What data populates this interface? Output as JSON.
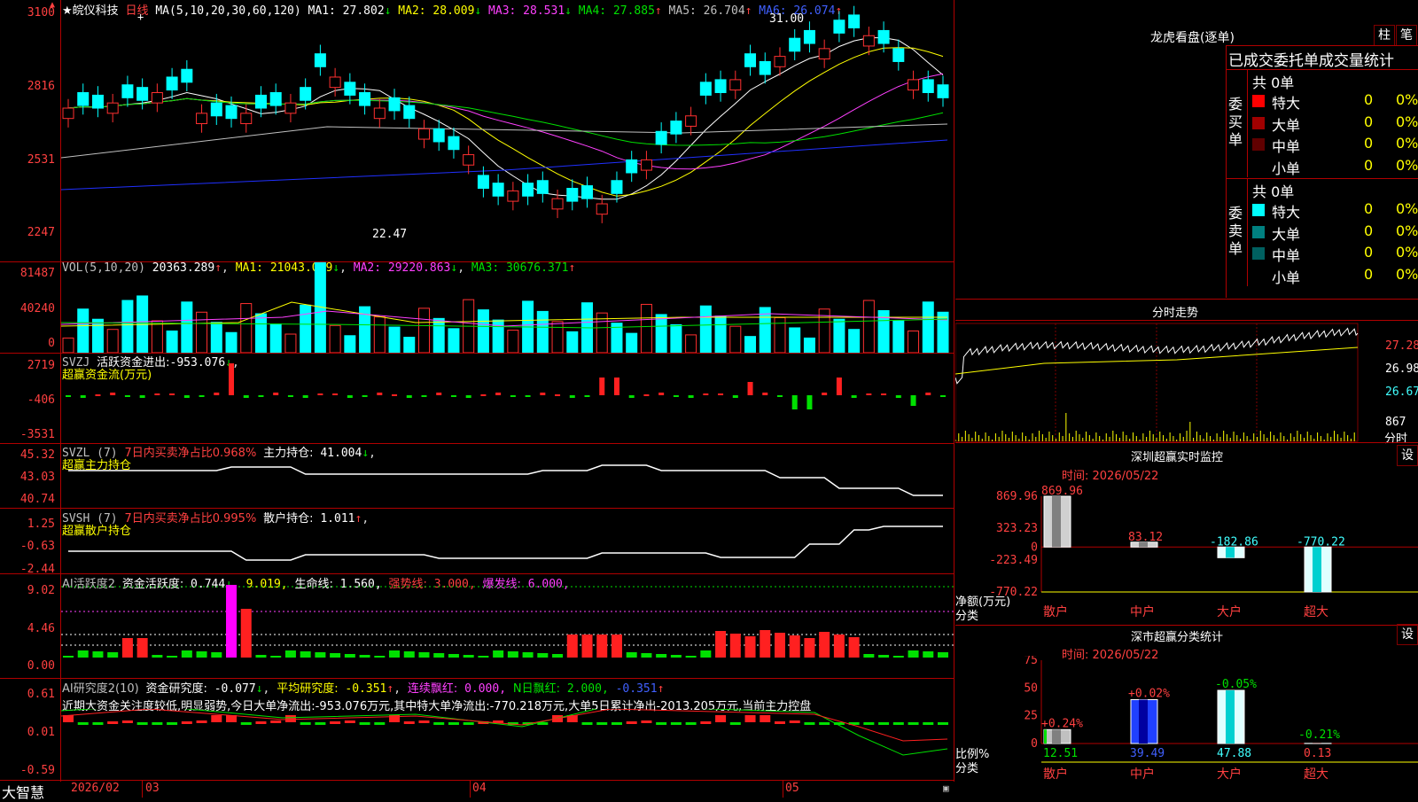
{
  "stock": {
    "name": "皖仪科技",
    "period": "日线",
    "star": "★"
  },
  "main": {
    "ma_label": "MA(5,10,20,30,60,120)",
    "ma": [
      {
        "name": "MA1",
        "value": "27.802",
        "arrow": "↓",
        "color": "#ffffff"
      },
      {
        "name": "MA2",
        "value": "28.009",
        "arrow": "↓",
        "color": "#ffff00"
      },
      {
        "name": "MA3",
        "value": "28.531",
        "arrow": "↓",
        "color": "#ff40ff"
      },
      {
        "name": "MA4",
        "value": "27.885",
        "arrow": "↑",
        "color": "#00e000"
      },
      {
        "name": "MA5",
        "value": "26.704",
        "arrow": "↑",
        "color": "#c0c0c0"
      },
      {
        "name": "MA6",
        "value": "26.074",
        "arrow": "↑",
        "color": "#4060ff"
      }
    ],
    "yticks": [
      "3100",
      "2816",
      "2531",
      "2247"
    ],
    "high_label": "31.00",
    "low_label": "22.47"
  },
  "vol": {
    "label": "VOL(5,10,20)",
    "value": "20363.289",
    "ma1": "21043.039",
    "ma2": "29220.863",
    "ma3": "30676.371",
    "yticks": [
      "81487",
      "40240",
      "0"
    ]
  },
  "svzj": {
    "label": "SVZJ",
    "name": "活跃资金进出:",
    "value": "-953.076",
    "sub": "超赢资金流(万元)",
    "yticks": [
      "2719",
      "-406",
      "-3531"
    ]
  },
  "svzl": {
    "label": "SVZL (7)",
    "ratio": "7日内买卖净占比0.968%",
    "main": "主力持仓:",
    "value": "41.004",
    "sub": "超赢主力持仓",
    "yticks": [
      "45.32",
      "43.03",
      "40.74"
    ]
  },
  "svsh": {
    "label": "SVSH (7)",
    "ratio": "7日内买卖净占比0.995%",
    "main": "散户持仓:",
    "value": "1.011",
    "sub": "超赢散户持仓",
    "yticks": [
      "1.25",
      "-0.63",
      "-2.44"
    ]
  },
  "ai1": {
    "label": "AI活跃度2",
    "a": "资金活跃度:",
    "av": "0.744",
    "b": "9.019,",
    "c": "生命线:",
    "cv": "1.560,",
    "d": "强势线:",
    "dv": "3.000,",
    "e": "爆发线:",
    "ev": "6.000,",
    "yticks": [
      "9.02",
      "4.46",
      "0.00"
    ]
  },
  "ai2": {
    "label": "AI研究度2(10)",
    "a": "资金研究度:",
    "av": "-0.077",
    "b": "平均研究度:",
    "bv": "-0.351",
    "c": "连续飘红:",
    "cv": "0.000,",
    "d": "N日飘红:",
    "dv": "2.000,",
    "e": "-0.351",
    "note": "近期大资金关注度较低,明显弱势,今日大单净流出:-953.076万元,其中特大单净流出:-770.218万元,大单5日累计净出-2013.205万元,当前主力控盘",
    "yticks": [
      "0.61",
      "0.01",
      "-0.59"
    ]
  },
  "xaxis": {
    "brand": "大智慧",
    "labels": [
      "2026/02",
      "03",
      "04",
      "05"
    ]
  },
  "right": {
    "title": "龙虎看盘(逐单)",
    "btn1": "柱",
    "btn2": "笔",
    "stat_title": "已成交委托单成交量统计",
    "buy": {
      "side": "委买单",
      "total": "共 0单",
      "rows": [
        {
          "name": "特大",
          "v": "0",
          "p": "0%",
          "color": "#ff0000"
        },
        {
          "name": "大单",
          "v": "0",
          "p": "0%",
          "color": "#a00000"
        },
        {
          "name": "中单",
          "v": "0",
          "p": "0%",
          "color": "#600000"
        },
        {
          "name": "小单",
          "v": "0",
          "p": "0%",
          "color": "#000000"
        }
      ]
    },
    "sell": {
      "side": "委卖单",
      "total": "共 0单",
      "rows": [
        {
          "name": "特大",
          "v": "0",
          "p": "0%",
          "color": "#00ffff"
        },
        {
          "name": "大单",
          "v": "0",
          "p": "0%",
          "color": "#008080"
        },
        {
          "name": "中单",
          "v": "0",
          "p": "0%",
          "color": "#006060"
        },
        {
          "name": "小单",
          "v": "0",
          "p": "0%",
          "color": "#000000"
        }
      ]
    },
    "intraday": {
      "title": "分时走势",
      "yticks": [
        "27.28",
        "26.98",
        "26.67"
      ],
      "vol": "867",
      "sub": "分时"
    },
    "monitor": {
      "title": "深圳超赢实时监控",
      "btn": "设",
      "time": "时间: 2026/05/22",
      "yticks": [
        "869.96",
        "323.23",
        "0",
        "-223.49",
        "-770.22"
      ],
      "ylabel": "净额(万元)",
      "xcat": "分类",
      "categories": [
        "散户",
        "中户",
        "大户",
        "超大"
      ],
      "values": [
        869.96,
        83.12,
        -182.86,
        -770.22
      ],
      "labels": [
        "869.96",
        "83.12",
        "-182.86",
        "-770.22"
      ]
    },
    "classify": {
      "title": "深市超赢分类统计",
      "btn": "设",
      "time": "时间: 2026/05/22",
      "yticks": [
        "75",
        "50",
        "25",
        "0"
      ],
      "ylabel": "比例%",
      "xcat": "分类",
      "categories": [
        "散户",
        "中户",
        "大户",
        "超大"
      ],
      "values": [
        12.51,
        39.49,
        47.88,
        0.13
      ],
      "changes": [
        "+0.24%",
        "+0.02%",
        "-0.05%",
        "-0.21%"
      ]
    }
  },
  "chart_data": [
    {
      "type": "candlestick",
      "title": "皖仪科技 日线",
      "ylim": [
        22.47,
        31.0
      ],
      "y_ticks": [
        "3100",
        "2816",
        "2531",
        "2247"
      ],
      "x_ticks": [
        "2026/02",
        "03",
        "04",
        "05"
      ]
    },
    {
      "type": "bar",
      "title": "深圳超赢实时监控",
      "categories": [
        "散户",
        "中户",
        "大户",
        "超大"
      ],
      "values": [
        869.96,
        83.12,
        -182.86,
        -770.22
      ],
      "ylabel": "净额(万元)",
      "ylim": [
        -770.22,
        869.96
      ]
    },
    {
      "type": "bar",
      "title": "深市超赢分类统计",
      "categories": [
        "散户",
        "中户",
        "大户",
        "超大"
      ],
      "values": [
        12.51,
        39.49,
        47.88,
        0.13
      ],
      "ylabel": "比例%",
      "ylim": [
        0,
        75
      ]
    }
  ]
}
